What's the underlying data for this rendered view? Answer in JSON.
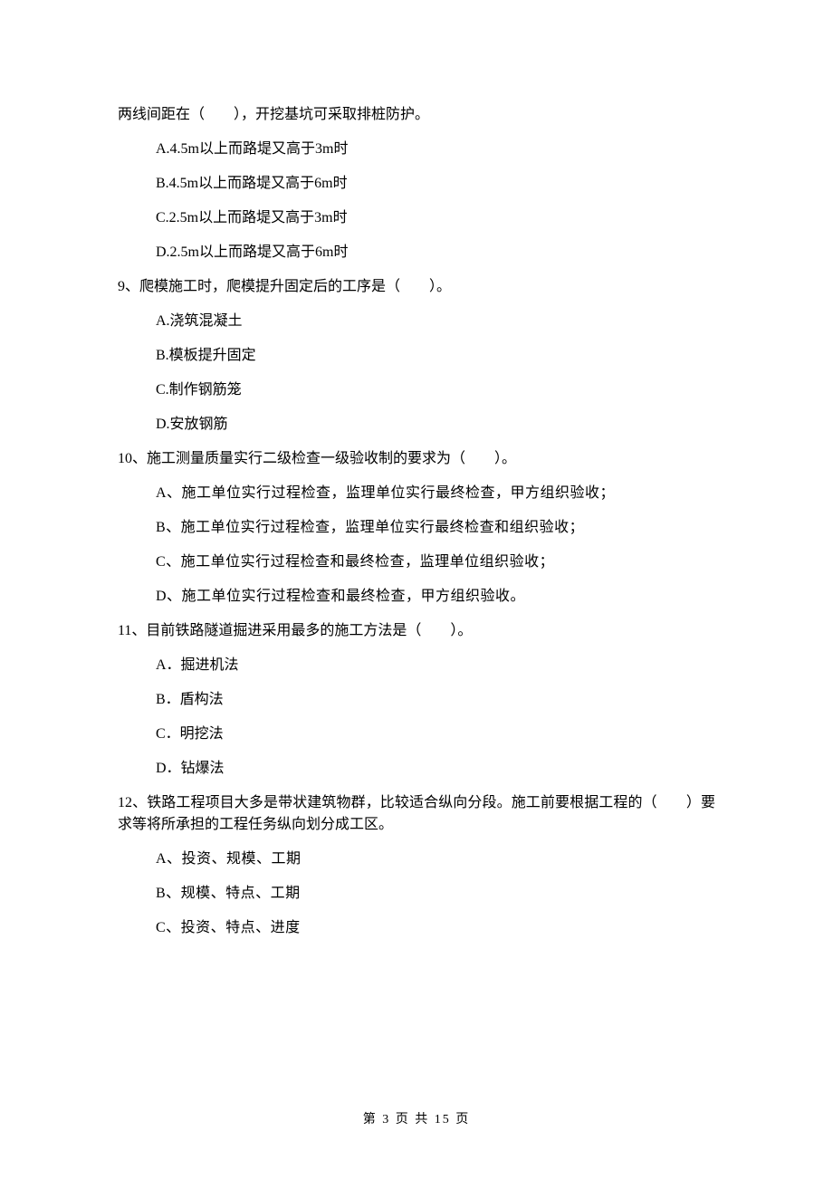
{
  "q8": {
    "continuation": "两线间距在（　　），开挖基坑可采取排桩防护。",
    "A": "A.4.5m以上而路堤又高于3m时",
    "B": "B.4.5m以上而路堤又高于6m时",
    "C": "C.2.5m以上而路堤又高于3m时",
    "D": "D.2.5m以上而路堤又高于6m时"
  },
  "q9": {
    "stem": "9、爬模施工时，爬模提升固定后的工序是（　　）。",
    "A": "A.浇筑混凝土",
    "B": "B.模板提升固定",
    "C": "C.制作钢筋笼",
    "D": "D.安放钢筋"
  },
  "q10": {
    "stem": "10、施工测量质量实行二级检查一级验收制的要求为（　　）。",
    "A": "A、施工单位实行过程检查，监理单位实行最终检查，甲方组织验收；",
    "B": "B、施工单位实行过程检查，监理单位实行最终检查和组织验收；",
    "C": "C、施工单位实行过程检查和最终检查，监理单位组织验收；",
    "D": "D、施工单位实行过程检查和最终检查，甲方组织验收。"
  },
  "q11": {
    "stem": "11、目前铁路隧道掘进采用最多的施工方法是（　　）。",
    "A": "A．掘进机法",
    "B": "B．盾构法",
    "C": "C．明挖法",
    "D": "D．钻爆法"
  },
  "q12": {
    "stem": "12、铁路工程项目大多是带状建筑物群，比较适合纵向分段。施工前要根据工程的（　　）要求等将所承担的工程任务纵向划分成工区。",
    "A": "A、投资、规模、工期",
    "B": "B、规模、特点、工期",
    "C": "C、投资、特点、进度"
  },
  "footer": "第 3 页 共 15 页"
}
